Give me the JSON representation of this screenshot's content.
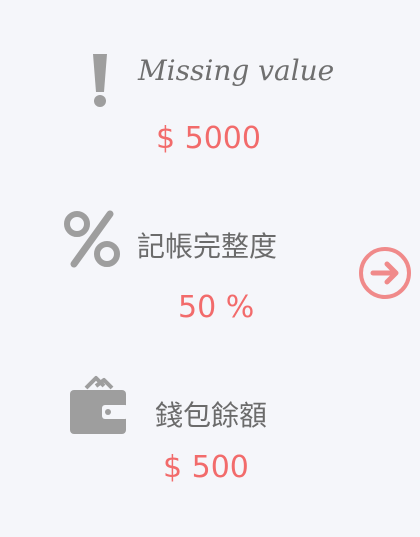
{
  "stats": [
    {
      "icon": "exclamation-icon",
      "label": "Missing value",
      "value": "$ 5000"
    },
    {
      "icon": "percent-icon",
      "label": "記帳完整度",
      "value": "50 %"
    },
    {
      "icon": "wallet-icon",
      "label": "錢包餘額",
      "value": "$ 500"
    }
  ],
  "next_button": {
    "icon": "arrow-right-circle-icon"
  },
  "colors": {
    "background": "#f5f6fa",
    "value": "#f26b6b",
    "label": "#6b6b6b",
    "icon": "#9e9e9e",
    "accent": "#f08a8a"
  }
}
